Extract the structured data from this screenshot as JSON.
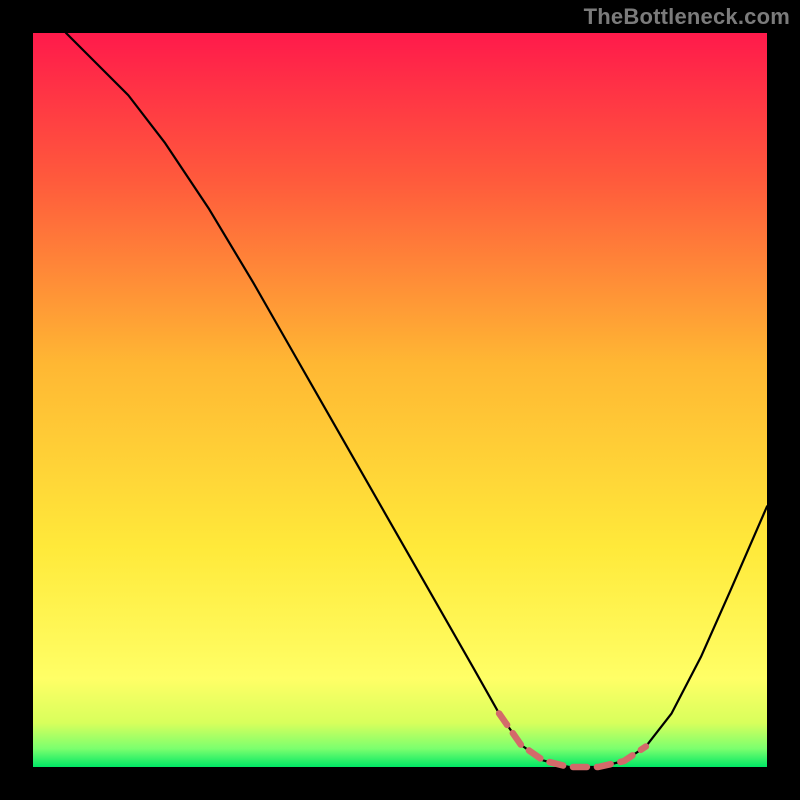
{
  "attribution": "TheBottleneck.com",
  "chart_data": {
    "type": "line",
    "title": "",
    "xlabel": "",
    "ylabel": "",
    "xlim": [
      0,
      100
    ],
    "ylim": [
      0,
      100
    ],
    "grid": false,
    "legend": false,
    "gradient_stops": [
      {
        "offset": 0.0,
        "color": "#ff1a4b"
      },
      {
        "offset": 0.2,
        "color": "#ff5a3c"
      },
      {
        "offset": 0.45,
        "color": "#ffb733"
      },
      {
        "offset": 0.7,
        "color": "#ffe93a"
      },
      {
        "offset": 0.88,
        "color": "#ffff66"
      },
      {
        "offset": 0.94,
        "color": "#d8ff5c"
      },
      {
        "offset": 0.975,
        "color": "#7bff6e"
      },
      {
        "offset": 1.0,
        "color": "#00e765"
      }
    ],
    "series": [
      {
        "name": "bottleneck-curve",
        "color": "#000000",
        "stroke_width": 2.2,
        "points": [
          {
            "x": 4.5,
            "y": 100.0
          },
          {
            "x": 9.0,
            "y": 95.5
          },
          {
            "x": 13.0,
            "y": 91.5
          },
          {
            "x": 18.0,
            "y": 85.0
          },
          {
            "x": 24.0,
            "y": 76.0
          },
          {
            "x": 30.0,
            "y": 66.0
          },
          {
            "x": 36.0,
            "y": 55.5
          },
          {
            "x": 42.0,
            "y": 45.0
          },
          {
            "x": 48.0,
            "y": 34.5
          },
          {
            "x": 54.0,
            "y": 24.0
          },
          {
            "x": 60.0,
            "y": 13.5
          },
          {
            "x": 63.5,
            "y": 7.3
          },
          {
            "x": 66.5,
            "y": 3.0
          },
          {
            "x": 69.5,
            "y": 0.9
          },
          {
            "x": 73.0,
            "y": 0.0
          },
          {
            "x": 77.0,
            "y": 0.0
          },
          {
            "x": 80.5,
            "y": 0.8
          },
          {
            "x": 83.5,
            "y": 2.8
          },
          {
            "x": 87.0,
            "y": 7.3
          },
          {
            "x": 91.0,
            "y": 15.0
          },
          {
            "x": 95.0,
            "y": 24.0
          },
          {
            "x": 100.0,
            "y": 35.5
          }
        ]
      },
      {
        "name": "minimum-highlight",
        "color": "#d36a6a",
        "stroke_width": 6.5,
        "points": [
          {
            "x": 63.5,
            "y": 7.3
          },
          {
            "x": 66.5,
            "y": 3.0
          },
          {
            "x": 69.5,
            "y": 0.9
          },
          {
            "x": 73.0,
            "y": 0.0
          },
          {
            "x": 77.0,
            "y": 0.0
          },
          {
            "x": 80.5,
            "y": 0.8
          },
          {
            "x": 83.5,
            "y": 2.8
          }
        ]
      }
    ]
  }
}
